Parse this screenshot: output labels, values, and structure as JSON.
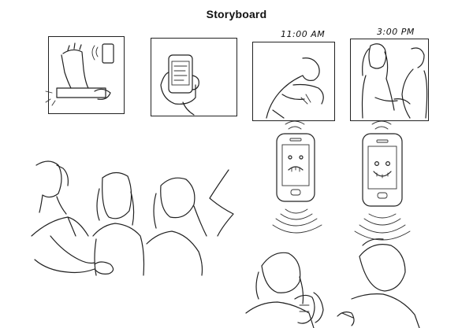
{
  "storyboard": {
    "title": "Storyboard",
    "panels": [
      {
        "id": "wrist-bracelet",
        "time": ""
      },
      {
        "id": "phone-in-hand",
        "time": ""
      },
      {
        "id": "sad-person",
        "time": "11:00 AM"
      },
      {
        "id": "happy-couple",
        "time": "3:00 PM"
      }
    ]
  }
}
